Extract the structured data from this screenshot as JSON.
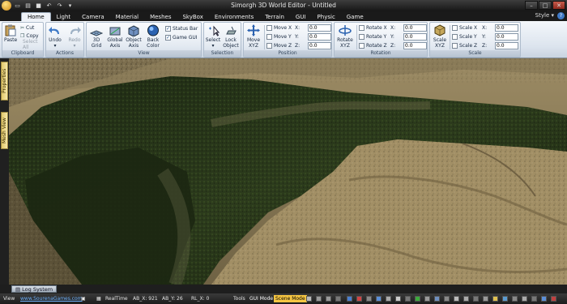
{
  "window": {
    "title": "Simorgh 3D World Editor - Untitled"
  },
  "tabs": [
    "Home",
    "Light",
    "Camera",
    "Material",
    "Meshes",
    "SkyBox",
    "Environments",
    "Terrain",
    "GUI",
    "Physic",
    "Game"
  ],
  "style_menu": "Style ▾",
  "ribbon": {
    "clipboard": {
      "label": "Clipboard",
      "paste": "Paste",
      "cut": "Cut",
      "copy": "Copy",
      "select_all": "Select All"
    },
    "actions": {
      "label": "Actions",
      "undo": "Undo",
      "redo": "Redo"
    },
    "view": {
      "label": "View",
      "grid": "3D Grid",
      "global_axis": "Global Axis",
      "object_axis": "Object Axis",
      "back_color": "Back Color",
      "status_bar": "Status Bar",
      "game_gui": "Game GUI"
    },
    "selection": {
      "label": "Selection",
      "select": "Select",
      "lock_object": "Lock Object"
    },
    "position": {
      "label": "Position",
      "move": "Move XYZ",
      "move_x": "Move X",
      "move_y": "Move Y",
      "move_z": "Move Z",
      "x_label": "X:",
      "y_label": "Y:",
      "z_label": "Z:",
      "x": "0.0",
      "y": "0.0",
      "z": "0.0"
    },
    "rotation": {
      "label": "Rotation",
      "rotate": "Rotate XYZ",
      "rotate_x": "Rotate X",
      "rotate_y": "Rotate Y",
      "rotate_z": "Rotate Z",
      "x_label": "X:",
      "y_label": "Y:",
      "z_label": "Z:",
      "x": "0.0",
      "y": "0.0",
      "z": "0.0"
    },
    "scale": {
      "label": "Scale",
      "scale": "Scale XYZ",
      "scale_x": "Scale X",
      "scale_y": "Scale Y",
      "scale_z": "Scale Z",
      "x_label": "X:",
      "y_label": "Y:",
      "z_label": "Z:",
      "x": "0.0",
      "y": "0.0",
      "z": "0.0"
    }
  },
  "side_tabs": {
    "properties": "Properties",
    "mesh_view": "Mesh View"
  },
  "log_tab": "Log System",
  "status": {
    "view": "View",
    "website": "www.SourenaGames.com",
    "realtime": "RealTime",
    "ab_x": "AB_X: 921",
    "ab_y": "AB_Y: 26",
    "rl_x": "RL_X: 0",
    "tools": "Tools",
    "gui_mode": "GUI Mode",
    "scene_mode": "Scene Mode"
  },
  "colors": {
    "accent": "#3f79c6",
    "scene_mode_bg": "#f5c542",
    "ribbon_bg": "#dce4ee"
  }
}
